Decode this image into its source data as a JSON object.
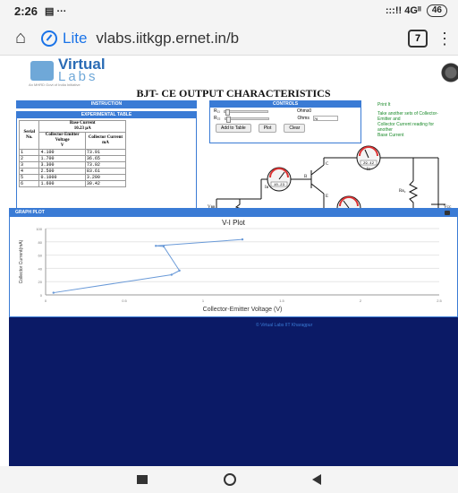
{
  "status_bar": {
    "time": "2:26",
    "icons_left": "▤ ···",
    "network": ":::!! 4Gᴵᴵ",
    "battery": "46"
  },
  "address_bar": {
    "lite_label": "Lite",
    "url": "vlabs.iitkgp.ernet.in/b",
    "tab_count": "7"
  },
  "page": {
    "logo_top": "Virtual",
    "logo_bottom": "Labs",
    "logo_sub": "An MHRD Govt of India Initiative",
    "title": "BJT- CE OUTPUT CHARACTERISTICS",
    "instruction_head": "INSTRUCTION",
    "experimental_head": "EXPERIMENTAL TABLE",
    "table": {
      "col_serial": "Serial No.",
      "col_base_current": "Base Current",
      "base_current_value": "10.23",
      "base_current_unit": "µA",
      "col_vce": "Collector-Emitter Voltage",
      "col_vce_unit": "V",
      "col_ic": "Collector Current mA",
      "rows": [
        {
          "sn": "1",
          "vce": "4.100",
          "ic": "73.91"
        },
        {
          "sn": "2",
          "vce": "1.700",
          "ic": "36.65"
        },
        {
          "sn": "3",
          "vce": "3.300",
          "ic": "73.02"
        },
        {
          "sn": "4",
          "vce": "2.500",
          "ic": "83.61"
        },
        {
          "sn": "5",
          "vce": "0.1000",
          "ic": "3.290"
        },
        {
          "sn": "6",
          "vce": "1.600",
          "ic": "30.42"
        }
      ]
    },
    "controls": {
      "head": "CONTROLS",
      "rb1_label": "R₁₁",
      "rb2_label": "R₂₂",
      "ohms1": "Ohms0",
      "ohms2": "Ohms",
      "ohms2_value": "76",
      "btn_add": "Add to Table",
      "btn_plot": "Plot",
      "btn_clear": "Clear"
    },
    "side_text": {
      "print": "Print It",
      "line1": "Take another sets of Collector-",
      "line2": "Emitter and",
      "line3": "Collector Current reading for",
      "line4": "another",
      "line5": "Base Current"
    },
    "circuit": {
      "meter_ib_value": "10.23",
      "meter_ic_value": "29.42",
      "meter_vbe_value": "0.0000",
      "meter_vce_value": "0.000",
      "label_ib": "Iʙ",
      "label_ic": "Iᴄ",
      "label_b": "B",
      "label_c": "C",
      "label_e": "E",
      "label_vbb": "Vʙʙ",
      "label_rb1": "Rʙ₁",
      "label_vbe": "Vʙᴇ",
      "label_vce": "Vᴄᴇ",
      "label_rb2": "Rʙ₂",
      "label_vcc": "Vᴄᴄ"
    },
    "graph": {
      "head": "GRAPH PLOT",
      "title": "V-I Plot",
      "link_text": "© Virtual Labs IIT Kharagpur"
    }
  },
  "chart_data": {
    "type": "line",
    "title": "V-I Plot",
    "xlabel": "Collector-Emitter Voltage (V)",
    "ylabel": "Collector Current(mA)",
    "xlim": [
      0,
      5
    ],
    "ylim": [
      0,
      100
    ],
    "x_ticks": [
      "0",
      "0.5",
      "1",
      "1.5",
      "2",
      "2.5"
    ],
    "y_ticks": [
      "0",
      "20",
      "40",
      "60",
      "80",
      "100"
    ],
    "series": [
      {
        "points": [
          {
            "x": 0.1,
            "y": 3.29
          },
          {
            "x": 1.6,
            "y": 30.42
          },
          {
            "x": 1.7,
            "y": 36.65
          },
          {
            "x": 1.5,
            "y": 73.0
          },
          {
            "x": 1.4,
            "y": 73.91
          },
          {
            "x": 2.5,
            "y": 83.61
          }
        ]
      }
    ],
    "color": "#6a9ad8",
    "grid": true
  }
}
